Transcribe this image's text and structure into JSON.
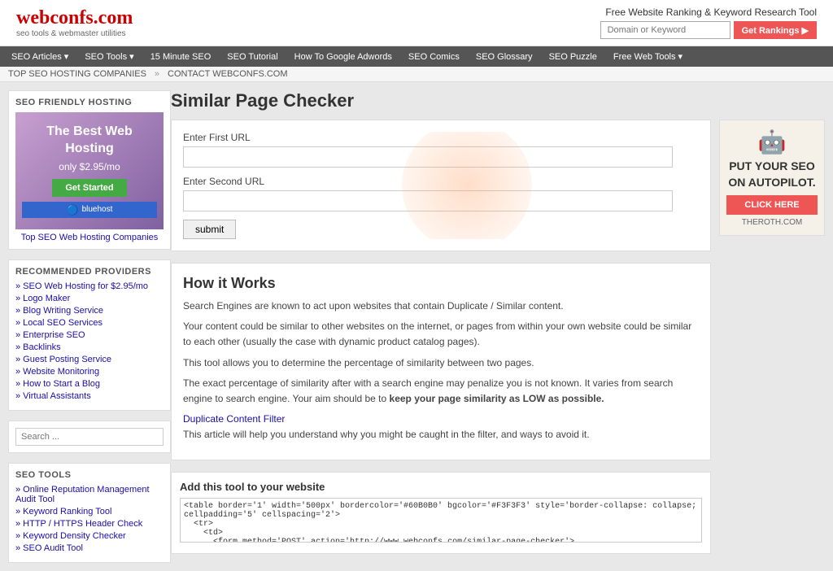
{
  "header": {
    "logo_main": "webconfs.com",
    "logo_sub": "seo tools & webmaster utilities",
    "ranking_tool_title": "Free Website Ranking & Keyword Research Tool",
    "ranking_input_placeholder": "Domain or Keyword",
    "ranking_button_label": "Get Rankings ▶"
  },
  "nav": {
    "items": [
      {
        "label": "SEO Articles",
        "has_arrow": true
      },
      {
        "label": "SEO Tools",
        "has_arrow": true
      },
      {
        "label": "15 Minute SEO",
        "has_arrow": false
      },
      {
        "label": "SEO Tutorial",
        "has_arrow": false
      },
      {
        "label": "How To Google Adwords",
        "has_arrow": false
      },
      {
        "label": "SEO Comics",
        "has_arrow": false
      },
      {
        "label": "SEO Glossary",
        "has_arrow": false
      },
      {
        "label": "SEO Puzzle",
        "has_arrow": false
      },
      {
        "label": "Free Web Tools",
        "has_arrow": true
      }
    ]
  },
  "sub_nav": {
    "items": [
      {
        "label": "TOP SEO HOSTING COMPANIES"
      },
      {
        "label": "CONTACT WEBCONFS.COM"
      }
    ]
  },
  "sidebar": {
    "hosting_section_title": "SEO FRIENDLY HOSTING",
    "hosting_tagline": "The Best Web Hosting",
    "hosting_price": "only $2.95/mo",
    "hosting_btn_label": "Get Started",
    "bluehost_label": "bluehost",
    "top_hosting_link": "Top SEO Web Hosting Companies",
    "recommended_section_title": "RECOMMENDED PROVIDERS",
    "recommended_links": [
      "SEO Web Hosting for $2.95/mo",
      "Logo Maker",
      "Blog Writing Service",
      "Local SEO Services",
      "Enterprise SEO",
      "Backlinks",
      "Guest Posting Service",
      "Website Monitoring",
      "How to Start a Blog",
      "Virtual Assistants"
    ],
    "search_placeholder": "Search ...",
    "seo_tools_title": "SEO TOOLS",
    "seo_tools_links": [
      "Online Reputation Management Audit Tool",
      "Keyword Ranking Tool",
      "HTTP / HTTPS Header Check",
      "Keyword Density Checker",
      "SEO Audit Tool"
    ]
  },
  "main": {
    "page_title": "Similar Page Checker",
    "form": {
      "first_url_label": "Enter First URL",
      "first_url_value": "",
      "second_url_label": "Enter Second URL",
      "second_url_value": "",
      "submit_label": "submit"
    },
    "how_it_works": {
      "title": "How it Works",
      "para1": "Search Engines are known to act upon websites that contain Duplicate / Similar content.",
      "para2": "Your content could be similar to other websites on the internet, or pages from within your own website could be similar to each other (usually the case with dynamic product catalog pages).",
      "para3": "This tool allows you to determine the percentage of similarity between two pages.",
      "para4": "The exact percentage of similarity after with a search engine may penalize you is not known. It varies from search engine to search engine. Your aim should be to keep your page similarity as LOW as possible.",
      "duplicate_filter_link": "Duplicate Content Filter",
      "para5": "This article will help you understand why you might be caught in the filter, and ways to avoid it."
    },
    "embed": {
      "title": "Add this tool to your website",
      "code": "<table border='1' width='500px' bordercolor='#60B0B0' bgcolor='#F3F3F3' style='border-collapse: collapse; cellpadding='5' cellspacing='2'>\n  <tr>\n    <td>\n      <form method='POST' action='http://www.webconfs.com/similar-page-checker'>"
    }
  },
  "ad": {
    "title": "PUT YOUR SEO ON AUTOPILOT.",
    "click_label": "CLICK HERE",
    "domain": "THEROTH.COM",
    "robot_emoji": "🤖"
  }
}
